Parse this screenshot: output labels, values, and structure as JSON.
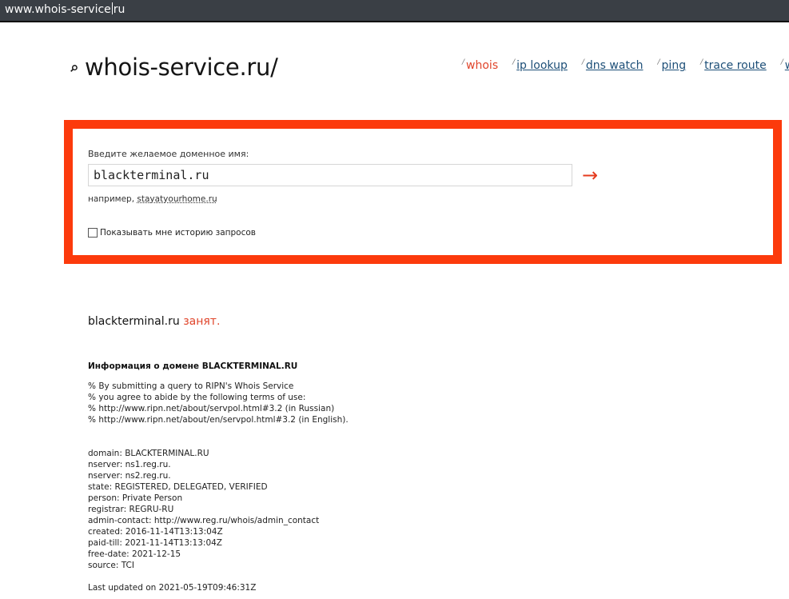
{
  "browser": {
    "url_before_caret": "www.whois-service",
    "url_after_caret": "ru"
  },
  "header": {
    "logo_icon": "search-icon",
    "logo_text": "whois-service.ru/",
    "nav": [
      {
        "label": "whois",
        "active": true
      },
      {
        "label": "ip lookup",
        "active": false
      },
      {
        "label": "dns watch",
        "active": false
      },
      {
        "label": "ping",
        "active": false
      },
      {
        "label": "trace route",
        "active": false
      },
      {
        "label": "w",
        "active": false
      }
    ]
  },
  "search": {
    "label": "Введите желаемое доменное имя:",
    "value": "blackterminal.ru",
    "submit_icon": "arrow-right-icon",
    "example_prefix": "например,",
    "example_link": "stayatyourhome.ru",
    "history_label": "Показывать мне историю запросов",
    "history_checked": false
  },
  "result": {
    "domain": "blackterminal.ru",
    "status": "занят."
  },
  "info": {
    "title": "Информация о домене BLACKTERMINAL.RU",
    "terms": [
      "% By submitting a query to RIPN's Whois Service",
      "% you agree to abide by the following terms of use:",
      "% http://www.ripn.net/about/servpol.html#3.2 (in Russian)",
      "% http://www.ripn.net/about/en/servpol.html#3.2 (in English)."
    ],
    "record": [
      "domain: BLACKTERMINAL.RU",
      "nserver: ns1.reg.ru.",
      "nserver: ns2.reg.ru.",
      "state: REGISTERED, DELEGATED, VERIFIED",
      "person: Private Person",
      "registrar: REGRU-RU",
      "admin-contact: http://www.reg.ru/whois/admin_contact",
      "created: 2016-11-14T13:13:04Z",
      "paid-till: 2021-11-14T13:13:04Z",
      "free-date: 2021-12-15",
      "source: TCI"
    ],
    "updated": "Last updated on 2021-05-19T09:46:31Z"
  },
  "colors": {
    "accent": "#fc3a0c",
    "link": "#1d4f78",
    "status": "#e0442a"
  }
}
